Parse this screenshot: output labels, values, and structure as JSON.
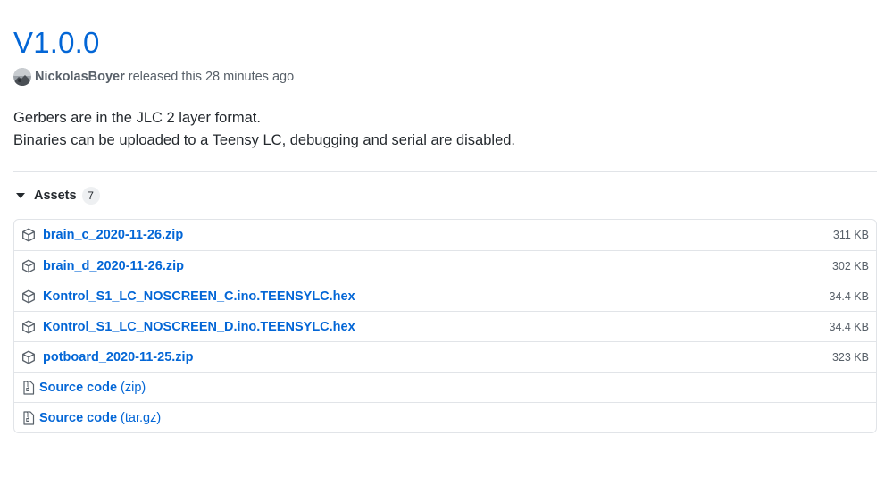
{
  "release": {
    "title": "V1.0.0",
    "author": "NickolasBoyer",
    "meta_text": "released this 28 minutes ago",
    "body_lines": [
      "Gerbers are in the JLC 2 layer format.",
      "Binaries can be uploaded to a Teensy LC, debugging and serial are disabled."
    ]
  },
  "assets": {
    "label": "Assets",
    "count": "7",
    "files": [
      {
        "name": "brain_c_2020-11-26.zip",
        "size": "311 KB"
      },
      {
        "name": "brain_d_2020-11-26.zip",
        "size": "302 KB"
      },
      {
        "name": "Kontrol_S1_LC_NOSCREEN_C.ino.TEENSYLC.hex",
        "size": "34.4 KB"
      },
      {
        "name": "Kontrol_S1_LC_NOSCREEN_D.ino.TEENSYLC.hex",
        "size": "34.4 KB"
      },
      {
        "name": "potboard_2020-11-25.zip",
        "size": "323 KB"
      }
    ],
    "sources": [
      {
        "label": "Source code",
        "format": "(zip)"
      },
      {
        "label": "Source code",
        "format": "(tar.gz)"
      }
    ]
  },
  "icons": {
    "asset": "package-icon",
    "source": "file-zip-icon",
    "caret": "triangle-down-icon"
  },
  "colors": {
    "link": "#0366d6",
    "text": "#24292e",
    "muted": "#586069",
    "border": "#e1e4e8"
  }
}
